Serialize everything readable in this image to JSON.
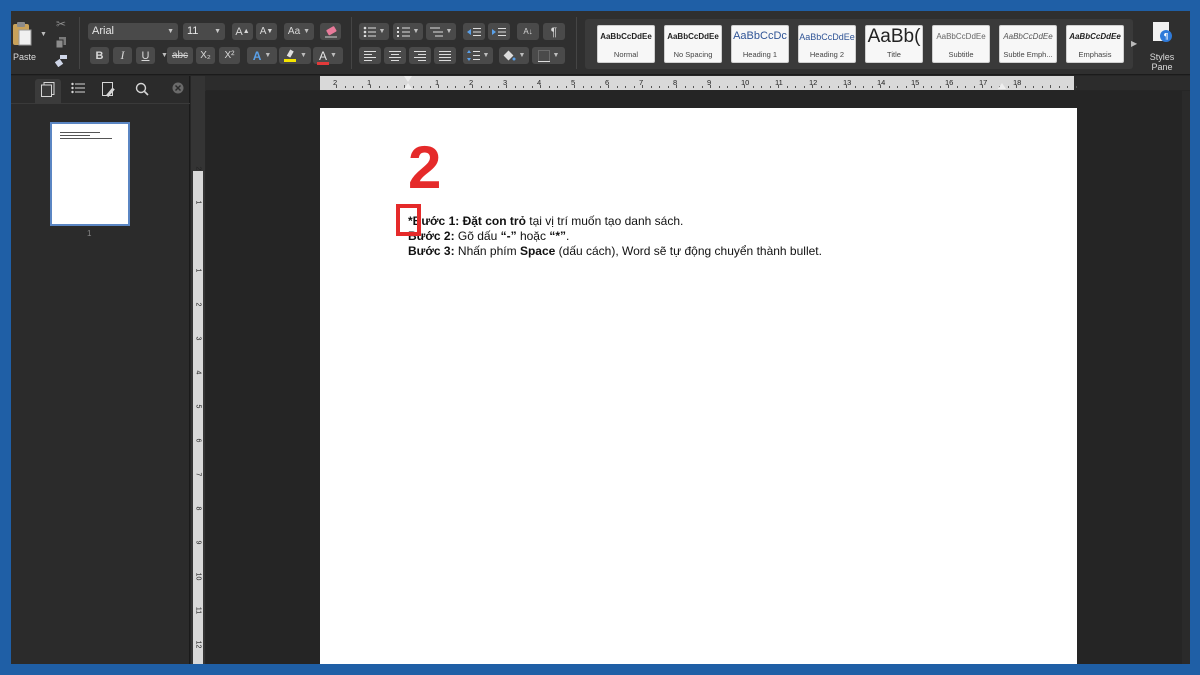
{
  "ribbon": {
    "paste_label": "Paste",
    "font_name": "Arial",
    "font_size": "11",
    "bold": "B",
    "italic": "I",
    "underline": "U",
    "strikethrough": "abc",
    "subscript": "X₂",
    "superscript": "X²",
    "styles": [
      {
        "preview": "AaBbCcDdEe",
        "label": "Normal"
      },
      {
        "preview": "AaBbCcDdEe",
        "label": "No Spacing"
      },
      {
        "preview": "AaBbCcDc",
        "label": "Heading 1"
      },
      {
        "preview": "AaBbCcDdEe",
        "label": "Heading 2"
      },
      {
        "preview": "AaBb(",
        "label": "Title"
      },
      {
        "preview": "AaBbCcDdEe",
        "label": "Subtitle"
      },
      {
        "preview": "AaBbCcDdEe",
        "label": "Subtle Emph..."
      },
      {
        "preview": "AaBbCcDdEe",
        "label": "Emphasis"
      }
    ],
    "styles_pane_label_1": "Styles",
    "styles_pane_label_2": "Pane"
  },
  "sidebar": {
    "page_number": "1"
  },
  "ruler": {
    "h_numbers": [
      "2",
      "1",
      "1",
      "2",
      "3",
      "4",
      "5",
      "6",
      "7",
      "8",
      "9",
      "10",
      "11",
      "12",
      "13",
      "14",
      "15",
      "16",
      "17",
      "18"
    ],
    "v_numbers": [
      "2",
      "1",
      "1",
      "2",
      "3",
      "4",
      "5",
      "6",
      "7",
      "8",
      "9",
      "10",
      "11",
      "12",
      "13"
    ]
  },
  "document": {
    "annotation_number": "2",
    "line1": {
      "prefix": "*",
      "bold": "Bước 1: Đặt con trỏ",
      "rest": " tại vị trí muốn tạo danh sách."
    },
    "line2": {
      "bold": "Bước 2:",
      "mid": " Gõ dấu ",
      "q1": "“-”",
      "mid2": " hoặc ",
      "q2": "“*”",
      "end": "."
    },
    "line3": {
      "bold": "Bước 3:",
      "mid": " Nhấn phím ",
      "key": "Space",
      "end": " (dấu cách), Word sẽ tự động chuyển thành bullet."
    }
  },
  "colors": {
    "frame": "#1f5fa6",
    "annotation": "#e52a2a",
    "highlight": "#f5e400",
    "font_color": "#e23a3a"
  }
}
